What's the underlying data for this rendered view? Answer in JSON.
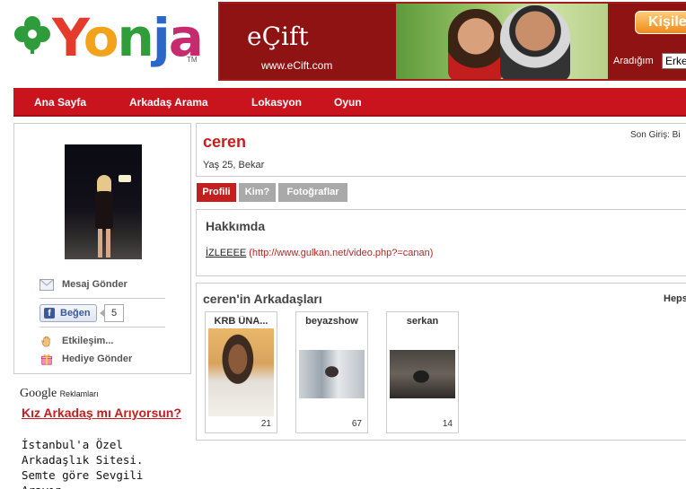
{
  "logo": {
    "text": "Yonja",
    "tm": "TM"
  },
  "banner": {
    "brand": "eÇift",
    "url": "www.eCift.com",
    "cta": "Kişile",
    "search_label": "Aradığım",
    "search_value": "Erke"
  },
  "nav": {
    "items": [
      {
        "label": "Ana Sayfa"
      },
      {
        "label": "Arkadaş Arama"
      },
      {
        "label": "Lokasyon"
      },
      {
        "label": "Oyun"
      }
    ]
  },
  "sidebar": {
    "actions": {
      "message": "Mesaj Gönder",
      "interact": "Etkileşim...",
      "gift": "Hediye Gönder"
    },
    "like": {
      "label": "Beğen",
      "count": "5"
    }
  },
  "ads": {
    "google": "Google",
    "reklam": "Reklamları",
    "title": "Kız Arkadaş mı Arıyorsun?",
    "body": "İstanbul'a Özel Arkadaşlık Sitesi. Semte göre Sevgili Arayın."
  },
  "profile": {
    "name": "ceren",
    "meta": "Yaş 25, Bekar",
    "last_login": "Son Giriş: Bi"
  },
  "tabs": [
    {
      "label": "Profili",
      "active": true
    },
    {
      "label": "Kim?",
      "active": false
    },
    {
      "label": "Fotoğraflar",
      "active": false
    }
  ],
  "about": {
    "heading": "Hakkımda",
    "link_text": "İZLEEEE",
    "link_url": "(http://www.gulkan.net/video.php?=canan)"
  },
  "friends": {
    "heading": "ceren'in Arkadaşları",
    "see_all": "Heps",
    "items": [
      {
        "name": "KRB ÜNA...",
        "count": "21"
      },
      {
        "name": "beyazshow",
        "count": "67"
      },
      {
        "name": "serkan",
        "count": "14"
      }
    ]
  },
  "colors": {
    "nav_red": "#c9141e",
    "name_red": "#c41e1e",
    "tab_inactive": "#a9a9a9"
  }
}
